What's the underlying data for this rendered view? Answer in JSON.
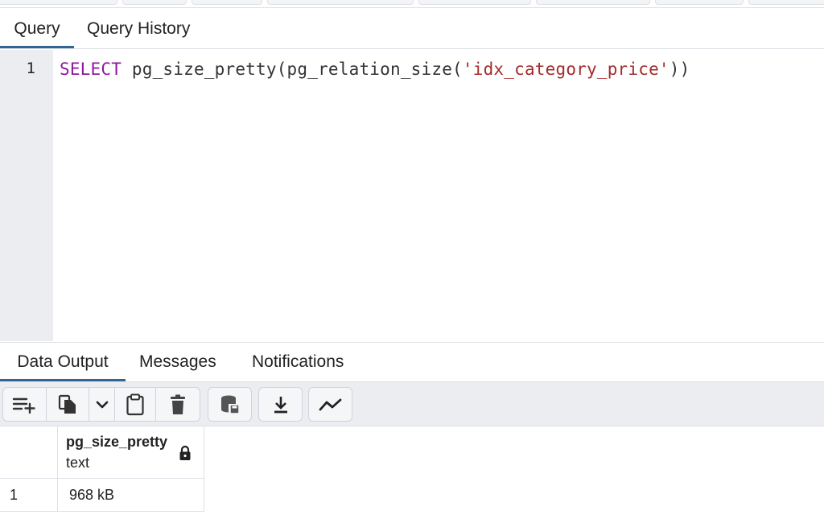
{
  "query_tabs": [
    {
      "label": "Query",
      "active": true
    },
    {
      "label": "Query History",
      "active": false
    }
  ],
  "editor": {
    "line_number": "1",
    "code": {
      "keyword": "SELECT",
      "call_open": "pg_size_pretty(pg_relation_size(",
      "string_literal": "'idx_category_price'",
      "call_close": "))"
    }
  },
  "result_tabs": [
    {
      "label": "Data Output",
      "active": true
    },
    {
      "label": "Messages",
      "active": false
    },
    {
      "label": "Notifications",
      "active": false
    }
  ],
  "result_toolbar": {
    "icons": [
      "add-row-icon",
      "copy-icon",
      "chevron-down-icon",
      "paste-icon",
      "delete-icon",
      "save-data-icon",
      "download-icon",
      "graph-visualiser-icon"
    ]
  },
  "grid": {
    "columns": [
      {
        "name": "pg_size_pretty",
        "type": "text",
        "locked": true
      }
    ],
    "rows": [
      {
        "row_number": "1",
        "values": [
          "968 kB"
        ]
      }
    ]
  },
  "colors": {
    "accent": "#326690",
    "keyword": "#8b1a9c",
    "string": "#a52a2a",
    "gutter": "#ebedf1"
  }
}
